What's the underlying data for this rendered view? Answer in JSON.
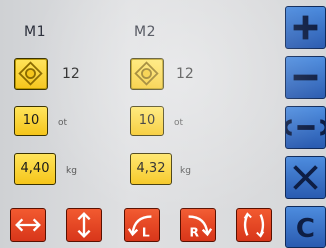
{
  "motors": [
    {
      "title": "M1",
      "step": "12",
      "count": "10",
      "count_unit": "ot",
      "weight": "4,40",
      "weight_unit": "kg"
    },
    {
      "title": "M2",
      "step": "12",
      "count": "10",
      "count_unit": "ot",
      "weight": "4,32",
      "weight_unit": "kg"
    }
  ],
  "side_buttons": [
    "plus-icon",
    "minus-icon",
    "wrench-icon",
    "cancel-icon",
    "c-icon"
  ],
  "side_letter": "C",
  "bottom_buttons": [
    {
      "icon": "horizontal-arrows-icon"
    },
    {
      "icon": "vertical-arrows-icon"
    },
    {
      "icon": "rotate-left-icon",
      "letter": "L"
    },
    {
      "icon": "rotate-right-icon",
      "letter": "R"
    },
    {
      "icon": "mirror-arrows-icon"
    }
  ],
  "colors": {
    "yellow": "#f5c51a",
    "red": "#d8361a",
    "blue": "#2a5bb0",
    "screen": "#d9dadc"
  }
}
